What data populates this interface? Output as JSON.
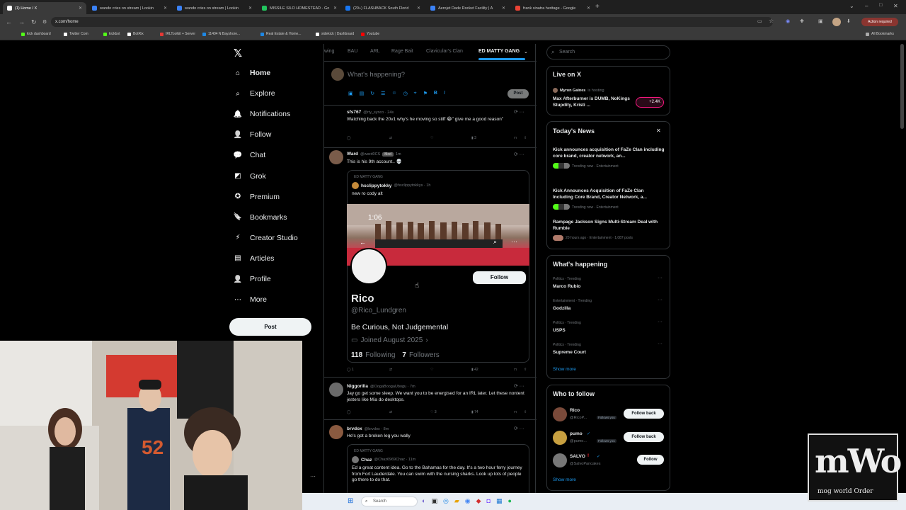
{
  "browser": {
    "tabs": [
      {
        "title": "(1) Home / X",
        "color": "#ffffff"
      },
      {
        "title": "wando cries on stream | Lookin",
        "color": "#3b82f6"
      },
      {
        "title": "wando cries on stream | Lookin",
        "color": "#3b82f6"
      },
      {
        "title": "MISSILE SILO HOMESTEAD - Go",
        "color": "#22c55e"
      },
      {
        "title": "(20+) FLASHBACK South Florid",
        "color": "#1877f2"
      },
      {
        "title": "Aerojet Dade Rocket Facility | A",
        "color": "#3b82f6"
      },
      {
        "title": "frank sinatra heritage - Google",
        "color": "#ea4335"
      }
    ],
    "url": "x.com/home",
    "action_required": "Action required",
    "bookmarks": [
      {
        "label": "kick dashboard",
        "color": "#53fc18"
      },
      {
        "label": "Twitter Com",
        "color": "#ffffff"
      },
      {
        "label": "kickbot",
        "color": "#53fc18"
      },
      {
        "label": "BotRix",
        "color": "#ffffff"
      },
      {
        "label": "IRLToolkit + Server",
        "color": "#e53935"
      },
      {
        "label": "11404 N Bayshore...",
        "color": "#1e88e5"
      },
      {
        "label": "Real Estate & Home...",
        "color": "#1e88e5"
      },
      {
        "label": "sidekick | Dashboard",
        "color": "#ffffff"
      },
      {
        "label": "Youtube",
        "color": "#ff0000"
      }
    ],
    "all_bookmarks": "All Bookmarks"
  },
  "nav": {
    "items": [
      "Home",
      "Explore",
      "Notifications",
      "Follow",
      "Chat",
      "Grok",
      "Premium",
      "Bookmarks",
      "Creator Studio",
      "Articles",
      "Profile",
      "More"
    ],
    "post": "Post"
  },
  "feed": {
    "tabs": [
      "wing",
      "BAU",
      "ARL",
      "Rage Bait",
      "Clavicular's Clan",
      "ED MATTY GANG"
    ],
    "compose_placeholder": "What's happening?",
    "compose_post": "Post",
    "posts": [
      {
        "name": "sfs767",
        "handle": "@rty_synco · 24s",
        "text": "Watching back the 20v1 why's he moving so stiff 😂\" give me a good reason\"",
        "views": "3"
      },
      {
        "name": "Ward",
        "handle": "@ward0CS",
        "badge": "Mod",
        "time": "1m",
        "text": "This is his 9th account.. 💀",
        "quote_context": "ED MATTY GANG",
        "quote_name": "hsclippytokky",
        "quote_handle": "@hsclippytokkys · 1h",
        "quote_text": "new ro cody alt",
        "card_time": "1:06",
        "card_name": "Rico",
        "card_handle": "@Rico_Lundgren",
        "card_bio": "Be Curious, Not Judgemental",
        "card_joined": "Joined August 2025",
        "card_following_n": "118",
        "card_following": "Following",
        "card_followers_n": "7",
        "card_followers": "Followers",
        "card_follow": "Follow",
        "replies": "1",
        "views": "42"
      },
      {
        "name": "Niggorilla",
        "handle": "@OogaBoogaUbogu · 7m",
        "text": "Jay go get some sleep. We want you to be energised for an IRL later. Let these nontent jesters like Mia do desktops.",
        "likes": "3",
        "views": "74"
      },
      {
        "name": "brvdox",
        "handle": "@brvdox · 8m",
        "text": "He's got a broken leg you wally",
        "quote_context": "ED MATTY GANG",
        "quote_name": "Chaz",
        "quote_handle": "@Chaz6969Chaz · 11m",
        "quote_text": "Ed a great content idea. Go to the Bahamas for the day. It's a two hour ferry journey from Fort Lauderdale. You can swim with the nursing sharks. Look up lots of people go there to do that."
      }
    ]
  },
  "right": {
    "search_placeholder": "Search",
    "live_title": "Live on X",
    "live_host": "Myron Gaines",
    "live_hosting": "is hosting",
    "live_text": "Max Afterburner is DUMB, NoKings Stupdity, Kristi ...",
    "live_count": "+2.4K",
    "news_title": "Today's News",
    "news": [
      {
        "headline": "Kick announces acquisition of FaZe Clan including core brand, creator network, an...",
        "meta": "Trending now · Entertainment"
      },
      {
        "headline": "Kick Announces Acquisition of FaZe Clan Including Core Brand, Creator Network, a...",
        "meta": "Trending now · Entertainment"
      },
      {
        "headline": "Rampage Jackson Signs Multi-Stream Deal with Rumble",
        "meta": "20 hours ago · Entertainment · 1,087 posts"
      }
    ],
    "happening_title": "What's happening",
    "trends": [
      {
        "cat": "Politics · Trending",
        "topic": "Marco Rubio"
      },
      {
        "cat": "Entertainment · Trending",
        "topic": "Godzilla"
      },
      {
        "cat": "Politics · Trending",
        "topic": "USPS"
      },
      {
        "cat": "Politics · Trending",
        "topic": "Supreme Court"
      }
    ],
    "show_more": "Show more",
    "wtf_title": "Who to follow",
    "follows": [
      {
        "name": "Rico",
        "handle": "@RicoP...",
        "follows_you": "Follows you",
        "btn": "Follow back"
      },
      {
        "name": "pumo",
        "handle": "@pumo...",
        "follows_you": "Follows you",
        "btn": "Follow back"
      },
      {
        "name": "SALVO",
        "handle": "@SalvoPancakes",
        "follows_you": "",
        "btn": "Follow"
      }
    ],
    "show_more2": "Show more"
  },
  "taskbar": {
    "search": "Search"
  },
  "overlay": {
    "logo_big": "mWo",
    "logo_small": "mog world Order"
  }
}
